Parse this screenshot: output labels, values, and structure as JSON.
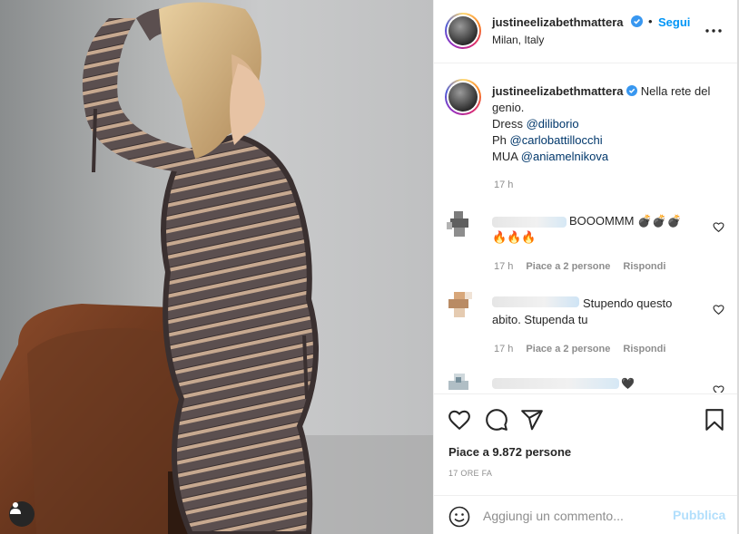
{
  "post": {
    "username": "justineelizabethmattera",
    "follow_label": "Segui",
    "separator": "•",
    "location": "Milan, Italy",
    "colors": {
      "link": "#00376b",
      "accent": "#0095f6",
      "muted": "#8e8e8e",
      "verified": "#3897f0"
    }
  },
  "caption": {
    "username": "justineelizabethmattera",
    "text": "Nella rete del genio.",
    "dress_label": "Dress",
    "dress_mention": "@diliborio",
    "ph_label": "Ph",
    "ph_mention": "@carlobattillocchi",
    "mua_label": "MUA",
    "mua_mention": "@aniamelnikova",
    "time": "17 h"
  },
  "comments": [
    {
      "text_line1": "BOOOMMM 💣💣💣",
      "text_line2": "🔥🔥🔥",
      "time": "17 h",
      "likes": "Piace a 2 persone",
      "reply": "Rispondi"
    },
    {
      "text_line1": "Stupendo questo",
      "text_line2": "abito. Stupenda tu",
      "time": "17 h",
      "likes": "Piace a 2 persone",
      "reply": "Rispondi"
    },
    {
      "text_line1": "🖤"
    }
  ],
  "actions": {
    "like_icon": "heart-icon",
    "comment_icon": "comment-bubble-icon",
    "share_icon": "paper-plane-icon",
    "save_icon": "bookmark-icon"
  },
  "likes": "Piace a 9.872 persone",
  "timestamp": "17 ORE FA",
  "add_comment": {
    "placeholder": "Aggiungi un commento...",
    "post_label": "Pubblica",
    "emoji_icon": "smiley-icon"
  }
}
